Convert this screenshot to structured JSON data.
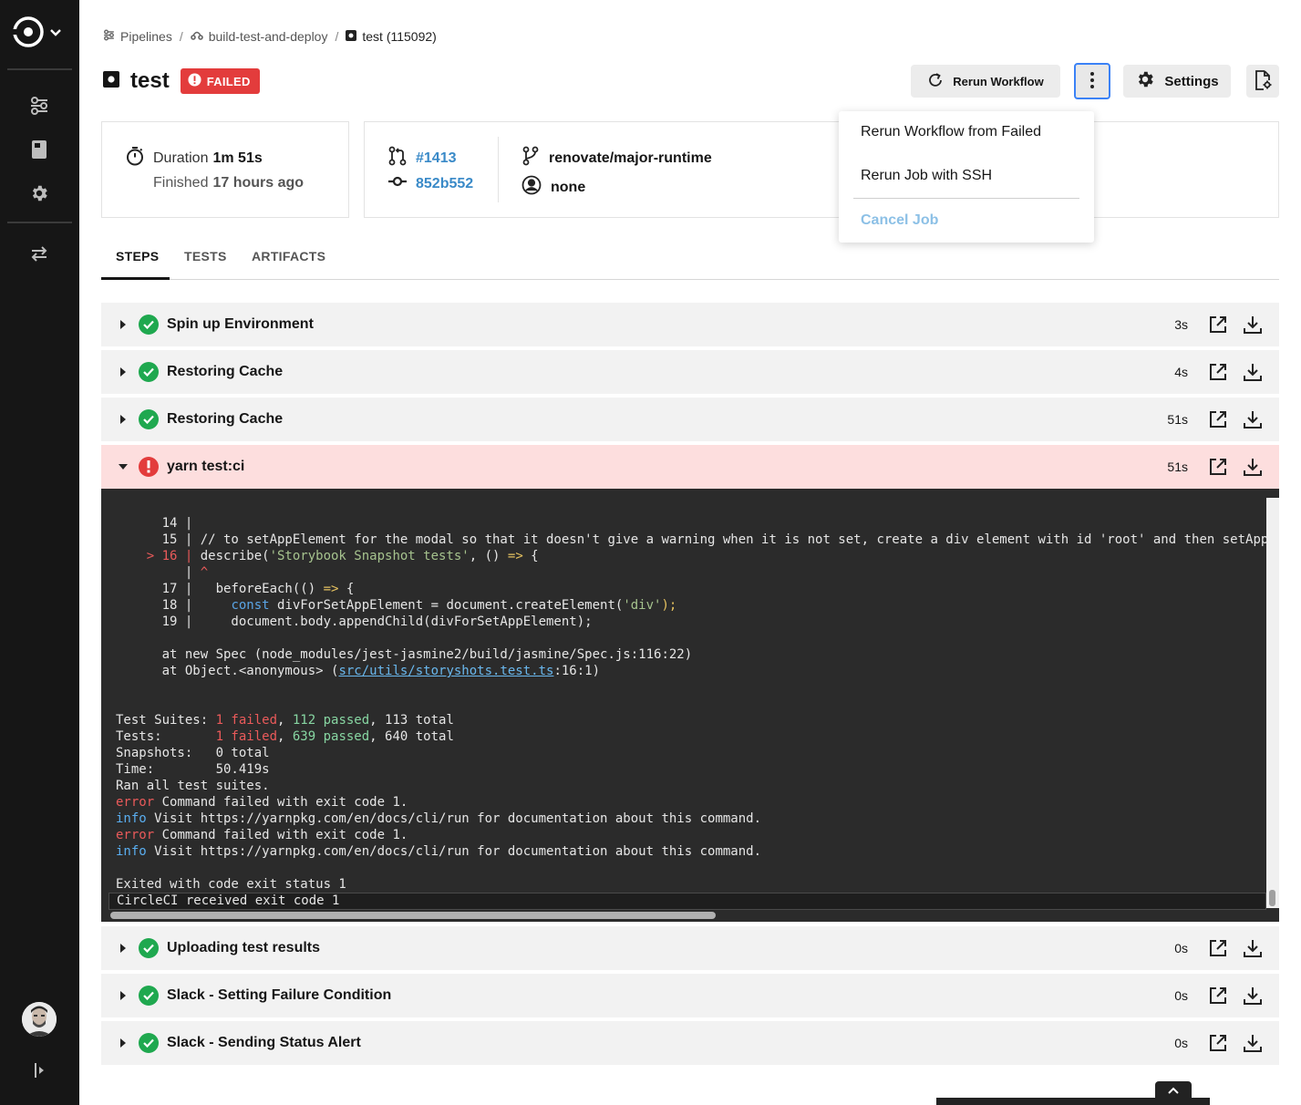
{
  "breadcrumb": {
    "pipelines": "Pipelines",
    "workflow": "build-test-and-deploy",
    "job": "test (115092)",
    "separator": "/"
  },
  "job": {
    "title": "test",
    "status": "FAILED"
  },
  "toolbar": {
    "rerun_workflow": "Rerun Workflow",
    "settings": "Settings"
  },
  "dropdown": {
    "items": [
      "Rerun Workflow from Failed",
      "Rerun Job with SSH"
    ],
    "disabled_item": "Cancel Job"
  },
  "summary": {
    "duration_label": "Duration",
    "duration_value": "1m 51s",
    "finished_label": "Finished",
    "finished_value": "17 hours ago",
    "pr": "#1413",
    "commit": "852b552",
    "branch": "renovate/major-runtime",
    "author": "none"
  },
  "tabs": [
    "STEPS",
    "TESTS",
    "ARTIFACTS"
  ],
  "steps": [
    {
      "name": "Spin up Environment",
      "duration": "3s",
      "status": "success"
    },
    {
      "name": "Restoring Cache",
      "duration": "4s",
      "status": "success"
    },
    {
      "name": "Restoring Cache",
      "duration": "51s",
      "status": "success"
    },
    {
      "name": "yarn test:ci",
      "duration": "51s",
      "status": "failed"
    },
    {
      "name": "Uploading test results",
      "duration": "0s",
      "status": "success"
    },
    {
      "name": "Slack - Setting Failure Condition",
      "duration": "0s",
      "status": "success"
    },
    {
      "name": "Slack - Sending Status Alert",
      "duration": "0s",
      "status": "success"
    }
  ],
  "terminal": {
    "l14": "      14 |",
    "l15": "      15 | // to setAppElement for the modal so that it doesn't give a warning when it is not set, create a div element with id 'root' and then setApp",
    "l16_marker": "    > 16 | ",
    "l16_a": "describe(",
    "l16_str": "'Storybook Snapshot tests'",
    "l16_b": ", () ",
    "l16_arrow": "=>",
    "l16_c": " {",
    "caret_prefix": "         | ",
    "caret": "^",
    "l17_a": "      17 |   beforeEach(() ",
    "l17_arrow": "=>",
    "l17_b": " {",
    "l18_a": "      18 |     ",
    "l18_kw": "const",
    "l18_b": " divForSetAppElement = document.createElement(",
    "l18_str": "'div'",
    "l18_c": ");",
    "l19": "      19 |     document.body.appendChild(divForSetAppElement);",
    "at1": "      at new Spec (node_modules/jest-jasmine2/build/jasmine/Spec.js:116:22)",
    "at2_a": "      at Object.<anonymous> (",
    "at2_path": "src/utils/storyshots.test.ts",
    "at2_b": ":16:1)",
    "suites_label": "Test Suites: ",
    "suites_failed": "1 failed",
    "suites_sep": ", ",
    "suites_passed": "112 passed",
    "suites_total": ", 113 total",
    "tests_label": "Tests:       ",
    "tests_failed": "1 failed",
    "tests_sep": ", ",
    "tests_passed": "639 passed",
    "tests_total": ", 640 total",
    "snapshots": "Snapshots:   0 total",
    "time": "Time:        50.419s",
    "ran": "Ran all test suites.",
    "error_kw": "error",
    "error_msg": " Command failed with exit code 1.",
    "info_kw": "info",
    "info_msg": " Visit https://yarnpkg.com/en/docs/cli/run for documentation about this command.",
    "exited": "Exited with code exit status 1",
    "received": "CircleCI received exit code 1"
  },
  "colors": {
    "failed": "#e33c3c",
    "success": "#1fa84f",
    "link": "#3a8ac8",
    "sidebar": "#161616"
  }
}
